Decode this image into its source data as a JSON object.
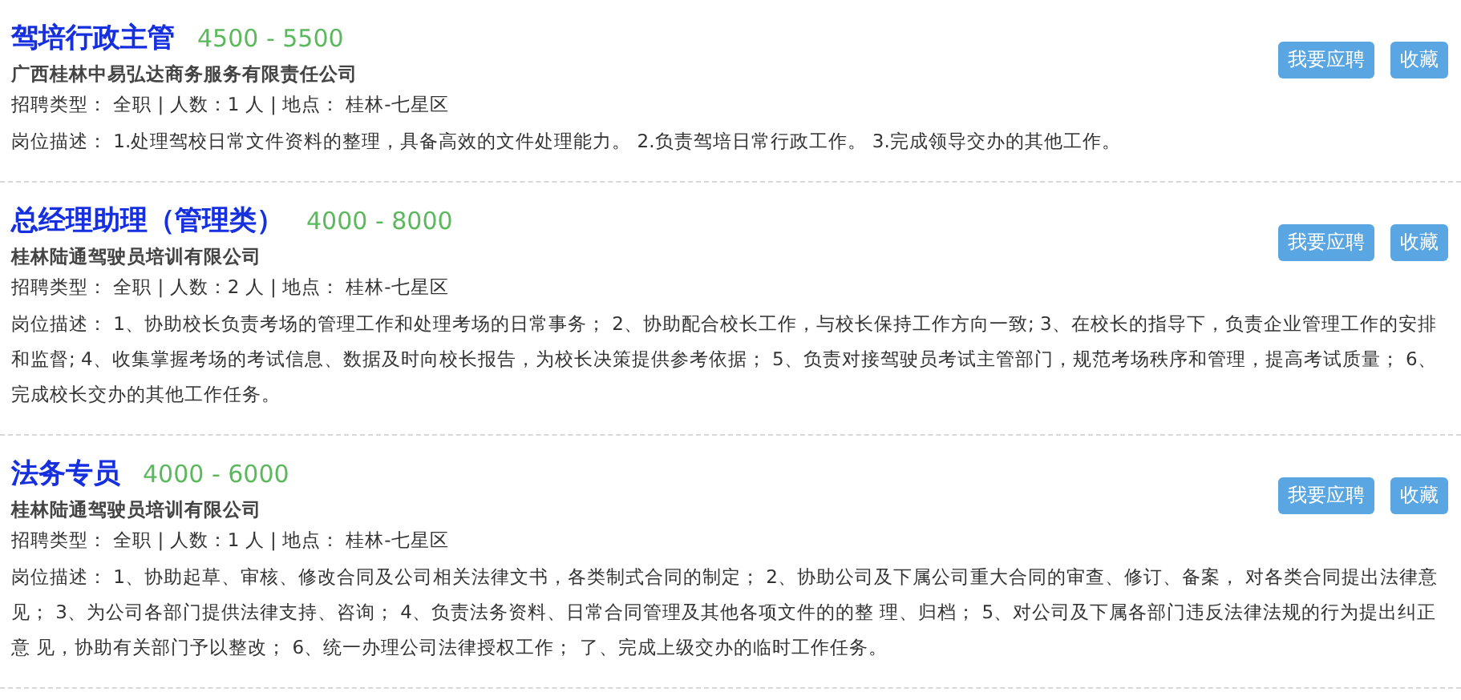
{
  "jobs": [
    {
      "title": "驾培行政主管",
      "salary": "4500 - 5500",
      "company": "广西桂林中易弘达商务服务有限责任公司",
      "meta": "招聘类型： 全职 | 人数：1 人 | 地点： 桂林-七星区",
      "description": "岗位描述： 1.处理驾校日常文件资料的整理，具备高效的文件处理能力。 2.负责驾培日常行政工作。 3.完成领导交办的其他工作。",
      "buttons": [
        "我要应聘",
        "收藏"
      ]
    },
    {
      "title": "总经理助理（管理类）",
      "salary": "4000 - 8000",
      "company": "桂林陆通驾驶员培训有限公司",
      "meta": "招聘类型： 全职 | 人数：2 人 | 地点： 桂林-七星区",
      "description": "岗位描述： 1、协助校长负责考场的管理工作和处理考场的日常事务； 2、协助配合校长工作，与校长保持工作方向一致; 3、在校长的指导下，负责企业管理工作的安排和监督; 4、收集掌握考场的考试信息、数据及时向校长报告，为校长决策提供参考依据； 5、负责对接驾驶员考试主管部门，规范考场秩序和管理，提高考试质量； 6、完成校长交办的其他工作任务。",
      "buttons": [
        "我要应聘",
        "收藏"
      ]
    },
    {
      "title": "法务专员",
      "salary": "4000 - 6000",
      "company": "桂林陆通驾驶员培训有限公司",
      "meta": "招聘类型： 全职 | 人数：1 人 | 地点： 桂林-七星区",
      "description": "岗位描述： 1、协助起草、审核、修改合同及公司相关法律文书，各类制式合同的制定； 2、协助公司及下属公司重大合同的审查、修订、备案， 对各类合同提出法律意见； 3、为公司各部门提供法律支持、咨询； 4、负责法务资料、日常合同管理及其他各项文件的的整 理、归档； 5、对公司及下属各部门违反法律法规的行为提出纠正意 见，协助有关部门予以整改； 6、统一办理公司法律授权工作； 了、完成上级交办的临时工作任务。",
      "buttons": [
        "我要应聘",
        "收藏"
      ]
    }
  ]
}
